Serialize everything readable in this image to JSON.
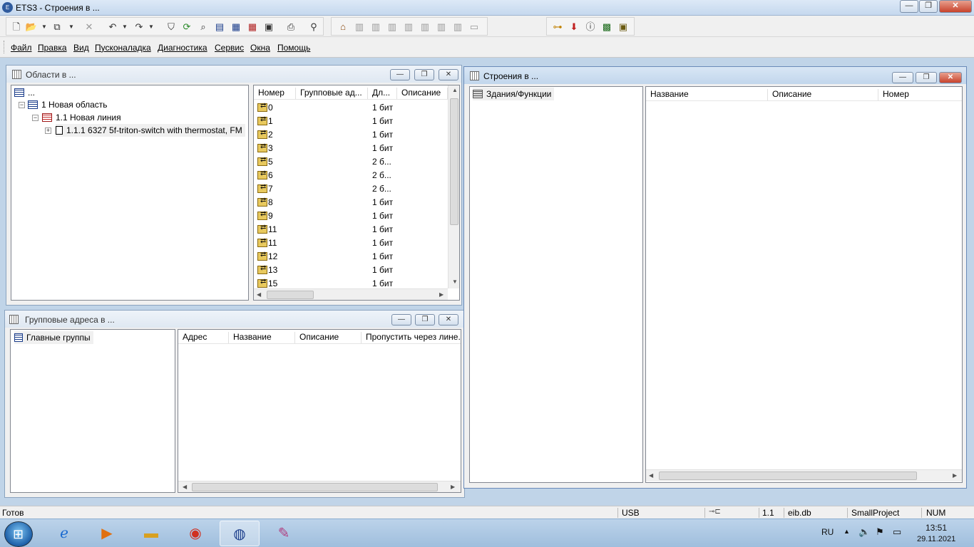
{
  "window": {
    "title": "ETS3 - Строения в ...",
    "minimize": "—",
    "restore": "❐",
    "close": "✕"
  },
  "toolbar": {
    "icons": [
      "new-icon",
      "open-icon",
      "copy-icon",
      "delete-icon",
      "undo-icon",
      "redo-icon",
      "filter-icon",
      "refresh-icon",
      "find-icon",
      "properties-icon",
      "table-icon",
      "table-red-icon",
      "panel-icon",
      "print-icon",
      "binoculars-icon",
      "building-icon",
      "function-icon",
      "connector-icon",
      "download-icon",
      "info-icon",
      "monitor-icon",
      "bus-monitor-icon"
    ]
  },
  "menu": {
    "items": [
      "Файл",
      "Правка",
      "Вид",
      "Пусконаладка",
      "Диагностика",
      "Сервис",
      "Окна",
      "Помощь"
    ]
  },
  "areas_window": {
    "title": "Области в ...",
    "tree": [
      {
        "label": "..."
      },
      {
        "label": "1 Новая область"
      },
      {
        "label": "1.1 Новая линия"
      },
      {
        "label": "1.1.1 6327 5f-triton-switch with thermostat, FM"
      }
    ],
    "columns": [
      "Номер",
      "Групповые ад...",
      "Дл...",
      "Описание"
    ],
    "rows": [
      {
        "num": "0",
        "len": "1 бит"
      },
      {
        "num": "1",
        "len": "1 бит"
      },
      {
        "num": "2",
        "len": "1 бит"
      },
      {
        "num": "3",
        "len": "1 бит"
      },
      {
        "num": "5",
        "len": "2 б..."
      },
      {
        "num": "6",
        "len": "2 б..."
      },
      {
        "num": "7",
        "len": "2 б..."
      },
      {
        "num": "8",
        "len": "1 бит"
      },
      {
        "num": "9",
        "len": "1 бит"
      },
      {
        "num": "11",
        "len": "1 бит"
      },
      {
        "num": "11",
        "len": "1 бит"
      },
      {
        "num": "12",
        "len": "1 бит"
      },
      {
        "num": "13",
        "len": "1 бит"
      },
      {
        "num": "15",
        "len": "1 бит"
      }
    ]
  },
  "group_window": {
    "title": "Групповые адреса в ...",
    "tree_root": "Главные группы",
    "columns": [
      "Адрес",
      "Название",
      "Описание",
      "Пропустить через лине..."
    ]
  },
  "buildings_window": {
    "title": "Строения в ...",
    "tree_root": "Здания/Функции",
    "columns": [
      "Название",
      "Описание",
      "Номер"
    ]
  },
  "statusbar": {
    "status": "Готов",
    "interface": "USB",
    "address": "1.1",
    "db": "eib.db",
    "project": "SmallProject",
    "num": "NUM"
  },
  "taskbar": {
    "lang": "RU",
    "time": "13:51",
    "date": "29.11.2021"
  }
}
